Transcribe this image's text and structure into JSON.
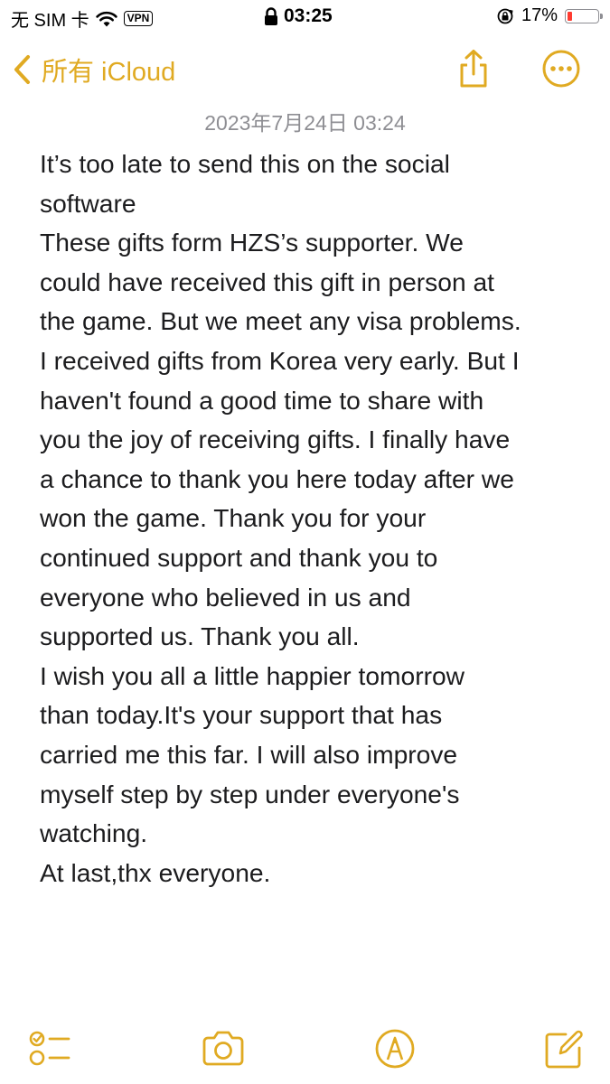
{
  "status_bar": {
    "carrier": "无 SIM 卡",
    "wifi_icon": "wifi-icon",
    "vpn": "VPN",
    "lock_icon": "lock-icon",
    "time": "03:25",
    "orientation_icon": "orientation-lock-icon",
    "battery_percent_label": "17%",
    "battery_level": 0.17,
    "battery_color": "#ff3b30"
  },
  "nav": {
    "back_label": "所有 iCloud",
    "back_icon": "chevron-left-icon",
    "share_icon": "share-icon",
    "more_icon": "ellipsis-circle-icon",
    "accent_color": "#e0aa22"
  },
  "note": {
    "date": "2023年7月24日 03:24",
    "lines": [
      "It’s too late to send this on the social",
      "software",
      "These gifts form HZS’s supporter. We",
      "could have received this gift in person at",
      "the game. But we meet any visa problems.",
      "I received gifts from Korea very early. But I",
      "haven't found a good time to share with",
      "you the joy of receiving gifts. I finally have",
      "a chance to thank you here today after we",
      "won the game. Thank you for your",
      "continued support and thank you to",
      "everyone who believed in us and",
      "supported us. Thank you all.",
      "I wish you all a little happier tomorrow",
      "than today.It's your support that has",
      "carried me this far. I will also improve",
      "myself step by step under everyone's",
      "watching.",
      "At last,thx everyone."
    ]
  },
  "toolbar": {
    "checklist_icon": "checklist-icon",
    "camera_icon": "camera-icon",
    "markup_icon": "markup-pen-icon",
    "compose_icon": "compose-icon"
  }
}
